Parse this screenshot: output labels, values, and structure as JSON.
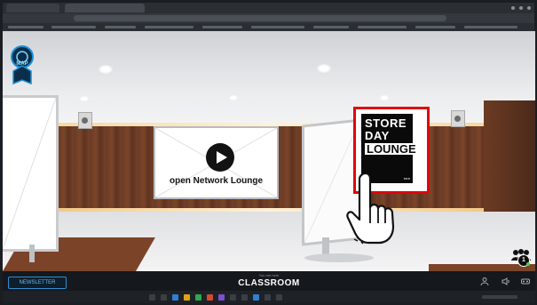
{
  "hud": {
    "map_label": "MAP",
    "visitor_count": "1"
  },
  "scene": {
    "center_screen_label": "open Network Lounge",
    "poster": {
      "line1": "STORE",
      "line2": "DAY",
      "line3": "LOUNGE"
    }
  },
  "bottom_bar": {
    "newsletter_label": "NEWSLETTER",
    "room_caption": "You are here",
    "room_name": "CLASSROOM"
  },
  "colors": {
    "poster_frame": "#e1060b",
    "newsletter_accent": "#2e8fd1",
    "status_dot": "#4ccf4a"
  },
  "icons": [
    "map-icon",
    "play-icon",
    "pointer-hand-icon",
    "visitors-icon",
    "person-icon",
    "volume-icon",
    "vr-headset-icon"
  ]
}
